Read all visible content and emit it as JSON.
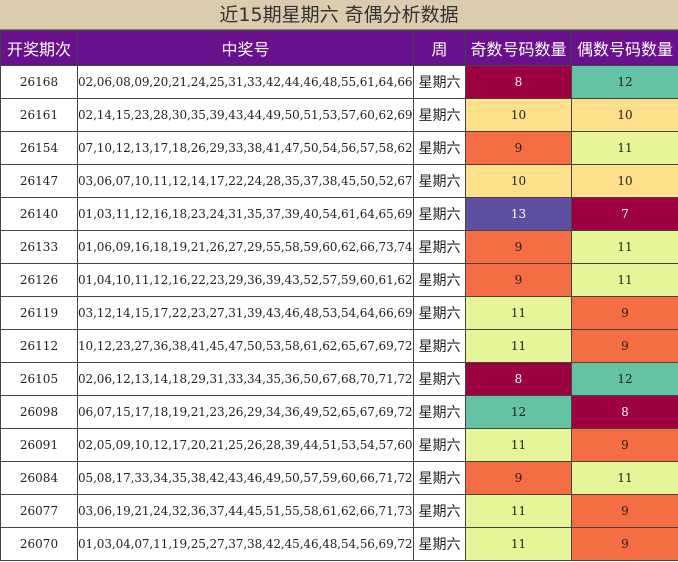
{
  "title": "近15期星期六 奇偶分析数据",
  "headers": {
    "period": "开奖期次",
    "numbers": "中奖号",
    "weekday": "周",
    "odd_count": "奇数号码数量",
    "even_count": "偶数号码数量"
  },
  "colors": {
    "7": "#9e0142",
    "8": "#9e0142",
    "9": "#f46d43",
    "10": "#fee08b",
    "11": "#e6f598",
    "12": "#66c2a5",
    "13": "#5e4fa2",
    "header_bg": "#6a0f8e",
    "title_bg": "#dcccaf"
  },
  "rows": [
    {
      "period": "26168",
      "numbers": "02,06,08,09,20,21,24,25,31,33,42,44,46,48,55,61,64,66,72,77",
      "weekday": "星期六",
      "odd": "8",
      "even": "12"
    },
    {
      "period": "26161",
      "numbers": "02,14,15,23,28,30,35,39,43,44,49,50,51,53,57,60,62,69,74,76",
      "weekday": "星期六",
      "odd": "10",
      "even": "10"
    },
    {
      "period": "26154",
      "numbers": "07,10,12,13,17,18,26,29,33,38,41,47,50,54,56,57,58,62,68,73",
      "weekday": "星期六",
      "odd": "9",
      "even": "11"
    },
    {
      "period": "26147",
      "numbers": "03,06,07,10,11,12,14,17,22,24,28,35,37,38,45,50,52,67,77,79",
      "weekday": "星期六",
      "odd": "10",
      "even": "10"
    },
    {
      "period": "26140",
      "numbers": "01,03,11,12,16,18,23,24,31,35,37,39,40,54,61,64,65,69,71,79",
      "weekday": "星期六",
      "odd": "13",
      "even": "7"
    },
    {
      "period": "26133",
      "numbers": "01,06,09,16,18,19,21,26,27,29,55,58,59,60,62,66,73,74,76,80",
      "weekday": "星期六",
      "odd": "9",
      "even": "11"
    },
    {
      "period": "26126",
      "numbers": "01,04,10,11,12,16,22,23,29,36,39,43,52,57,59,60,61,62,64,74",
      "weekday": "星期六",
      "odd": "9",
      "even": "11"
    },
    {
      "period": "26119",
      "numbers": "03,12,14,15,17,22,23,27,31,39,43,46,48,53,54,64,66,69,77,78",
      "weekday": "星期六",
      "odd": "11",
      "even": "9"
    },
    {
      "period": "26112",
      "numbers": "10,12,23,27,36,38,41,45,47,50,53,58,61,62,65,67,69,72,75,76",
      "weekday": "星期六",
      "odd": "11",
      "even": "9"
    },
    {
      "period": "26105",
      "numbers": "02,06,12,13,14,18,29,31,33,34,35,36,50,67,68,70,71,72,76,77",
      "weekday": "星期六",
      "odd": "8",
      "even": "12"
    },
    {
      "period": "26098",
      "numbers": "06,07,15,17,18,19,21,23,26,29,34,36,49,52,65,67,69,72,77,80",
      "weekday": "星期六",
      "odd": "12",
      "even": "8"
    },
    {
      "period": "26091",
      "numbers": "02,05,09,10,12,17,20,21,25,26,28,39,44,51,53,54,57,60,65,67",
      "weekday": "星期六",
      "odd": "11",
      "even": "9"
    },
    {
      "period": "26084",
      "numbers": "05,08,17,33,34,35,38,42,43,46,49,50,57,59,60,66,71,72,74,80",
      "weekday": "星期六",
      "odd": "9",
      "even": "11"
    },
    {
      "period": "26077",
      "numbers": "03,06,19,21,24,32,36,37,44,45,51,55,58,61,62,66,71,73,74,75",
      "weekday": "星期六",
      "odd": "11",
      "even": "9"
    },
    {
      "period": "26070",
      "numbers": "01,03,04,07,11,19,25,27,37,38,42,45,46,48,54,56,69,72,76,77",
      "weekday": "星期六",
      "odd": "11",
      "even": "9"
    }
  ]
}
